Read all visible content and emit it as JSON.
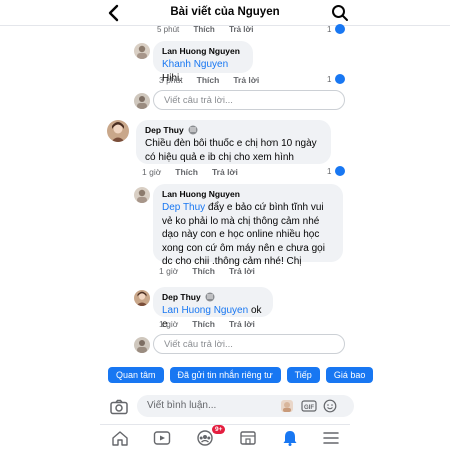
{
  "header": {
    "title": "Bài viết của Nguyen"
  },
  "partial": {
    "time": "5 phút",
    "like": "Thích",
    "reply": "Trả lời",
    "count": "1"
  },
  "comment1": {
    "author": "Lan Huong Nguyen",
    "mention": "Khanh Nguyen",
    "text": " Hihi.",
    "time": "3 phút",
    "like": "Thích",
    "reply": "Trả lời",
    "count": "1"
  },
  "reply_input_1": {
    "placeholder": "Viết câu trả lời..."
  },
  "comment2": {
    "author": "Dep Thuy",
    "text": "Chiều đèn bôi thuốc e chị hơn 10 ngày có hiệu quả e ib chị cho xem hình",
    "time": "1 giờ",
    "like": "Thích",
    "reply": "Trả lời",
    "count": "1"
  },
  "comment3": {
    "author": "Lan Huong Nguyen",
    "mention": "Dep Thuy",
    "text": " đẩy e bảo cứ bình tĩnh vui vẻ ko phải lo mà chị thông cảm nhé dạo này con e học online nhiều học xong con cứ ôm máy nên e chưa gọi dc cho chii .thông cảm nhé! Chị",
    "time": "1 giờ",
    "like": "Thích",
    "reply": "Trả lời"
  },
  "comment4": {
    "author": "Dep Thuy",
    "mention": "Lan Huong Nguyen",
    "text": " ok e",
    "time": "1 giờ",
    "like": "Thích",
    "reply": "Trả lời"
  },
  "reply_input_2": {
    "placeholder": "Viết câu trả lời..."
  },
  "chips": [
    "Quan tâm",
    "Đã gửi tin nhắn riêng tư",
    "Tiếp",
    "Giá bao"
  ],
  "composer": {
    "placeholder": "Viết bình luận..."
  },
  "tabbar": {
    "badge": "9+"
  },
  "colors": {
    "accent": "#1877f2",
    "bubble": "#f0f2f5",
    "muted": "#65676b",
    "badge": "#e41e3f"
  }
}
